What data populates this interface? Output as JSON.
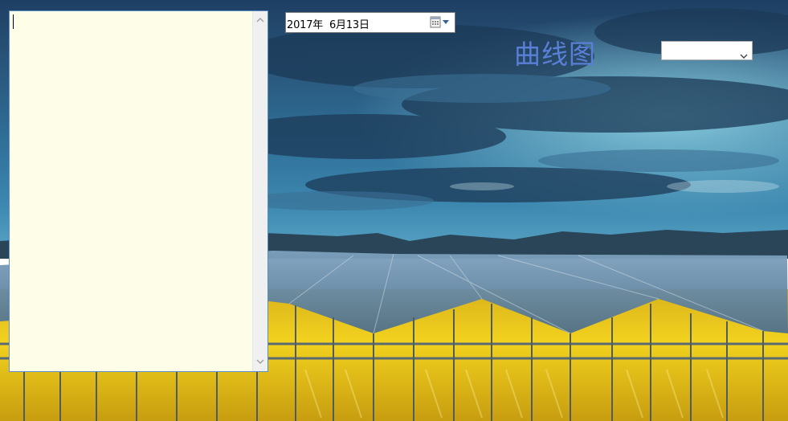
{
  "log_box": {
    "value": ""
  },
  "date_picker": {
    "value": "2017年  6月13日"
  },
  "title": "曲线图",
  "combo": {
    "selected": ""
  },
  "icons": {
    "scroll_up": "chevron-up-icon",
    "scroll_down": "chevron-down-icon",
    "calendar": "calendar-icon",
    "date_dropdown": "triangle-down-icon",
    "combo_dropdown": "chevron-down-icon"
  },
  "colors": {
    "log_box_background": "#fefee8",
    "log_box_border": "#5b8fc9",
    "title": "#5a7fd6",
    "scrollbar_track": "#f0f0f0"
  }
}
